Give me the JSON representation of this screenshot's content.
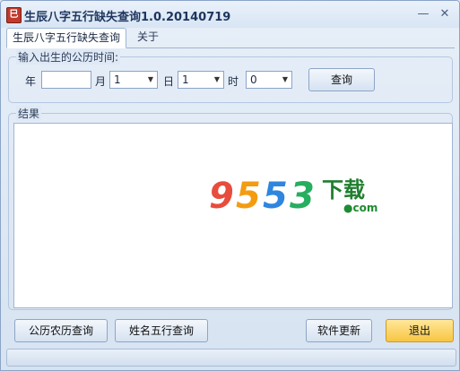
{
  "window": {
    "title": "生辰八字五行缺失查询1.0.20140719",
    "minimize_glyph": "—",
    "close_glyph": "✕"
  },
  "tabs": [
    {
      "label": "生辰八字五行缺失查询",
      "active": true
    },
    {
      "label": "关于",
      "active": false
    }
  ],
  "input_group": {
    "legend": "输入出生的公历时间:",
    "year_label": "年",
    "year_value": "",
    "month_label": "月",
    "month_value": "1",
    "day_label": "日",
    "day_value": "1",
    "hour_label": "时",
    "hour_value": "0",
    "query_button": "查询"
  },
  "results_group": {
    "legend": "结果",
    "content": ""
  },
  "watermark": {
    "digits": [
      "9",
      "5",
      "5",
      "3"
    ],
    "digit_colors": [
      "#e84c3d",
      "#f39c12",
      "#2e86de",
      "#27ae60"
    ],
    "chinese": "下载",
    "domain": "●com"
  },
  "buttons": {
    "lunar_solar": "公历农历查询",
    "name_five_elements": "姓名五行查询",
    "update": "软件更新",
    "exit": "退出"
  },
  "colors": {
    "exit_button": "#f7c541",
    "accent_border": "#8aa4c8"
  }
}
